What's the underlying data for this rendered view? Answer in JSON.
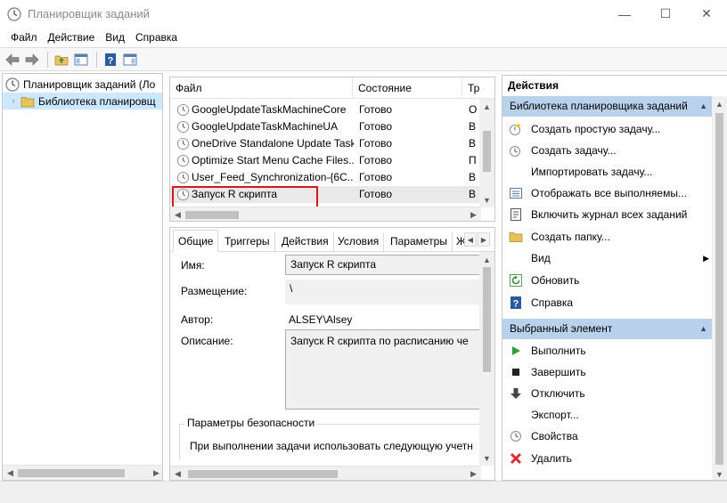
{
  "window": {
    "title": "Планировщик заданий",
    "minimize": "—",
    "maximize": "☐",
    "close": "✕"
  },
  "menu": [
    "Файл",
    "Действие",
    "Вид",
    "Справка"
  ],
  "tree": {
    "root": "Планировщик заданий (Ло",
    "library": "Библиотека планировщ"
  },
  "task_list": {
    "columns": [
      "Файл",
      "Состояние",
      "Тр"
    ],
    "rows": [
      {
        "name": "GoogleUpdateTaskMachineCore",
        "status": "Готово",
        "trigger": "О"
      },
      {
        "name": "GoogleUpdateTaskMachineUA",
        "status": "Готово",
        "trigger": "В"
      },
      {
        "name": "OneDrive Standalone Update Task",
        "status": "Готово",
        "trigger": "В"
      },
      {
        "name": "Optimize Start Menu Cache Files...",
        "status": "Готово",
        "trigger": "П"
      },
      {
        "name": "User_Feed_Synchronization-{6C...",
        "status": "Готово",
        "trigger": "В"
      },
      {
        "name": "Запуск R скрипта",
        "status": "Готово",
        "trigger": "В"
      }
    ]
  },
  "details": {
    "tabs": [
      "Общие",
      "Триггеры",
      "Действия",
      "Условия",
      "Параметры",
      "Ж"
    ],
    "name_label": "Имя:",
    "name_value": "Запуск R скрипта",
    "location_label": "Размещение:",
    "location_value": "\\",
    "author_label": "Автор:",
    "author_value": "ALSEY\\Alsey",
    "description_label": "Описание:",
    "description_value": "Запуск R скрипта по расписанию че",
    "security_group": "Параметры безопасности",
    "security_text": "При выполнении задачи использовать следующую учетн"
  },
  "actions": {
    "header": "Действия",
    "section_library": "Библиотека планировщика заданий",
    "library_items": [
      {
        "label": "Создать простую задачу...",
        "icon": "create-basic-task-icon"
      },
      {
        "label": "Создать задачу...",
        "icon": "create-task-icon"
      },
      {
        "label": "Импортировать задачу...",
        "icon": ""
      },
      {
        "label": "Отображать все выполняемы...",
        "icon": "running-tasks-icon"
      },
      {
        "label": "Включить журнал всех заданий",
        "icon": "history-icon"
      },
      {
        "label": "Создать папку...",
        "icon": "folder-icon"
      },
      {
        "label": "Вид",
        "icon": ""
      },
      {
        "label": "Обновить",
        "icon": "refresh-icon"
      },
      {
        "label": "Справка",
        "icon": "help-icon"
      }
    ],
    "section_selected": "Выбранный элемент",
    "selected_items": [
      {
        "label": "Выполнить",
        "icon": "run-icon"
      },
      {
        "label": "Завершить",
        "icon": "end-icon"
      },
      {
        "label": "Отключить",
        "icon": "disable-icon"
      },
      {
        "label": "Экспорт...",
        "icon": ""
      },
      {
        "label": "Свойства",
        "icon": "properties-icon"
      },
      {
        "label": "Удалить",
        "icon": "delete-icon"
      }
    ]
  },
  "colors": {
    "selection": "#cce8ff",
    "section_header": "#b9d1ea",
    "highlight_border": "#d8151b",
    "run_green": "#2e9d3a",
    "delete_red": "#d9282f"
  }
}
